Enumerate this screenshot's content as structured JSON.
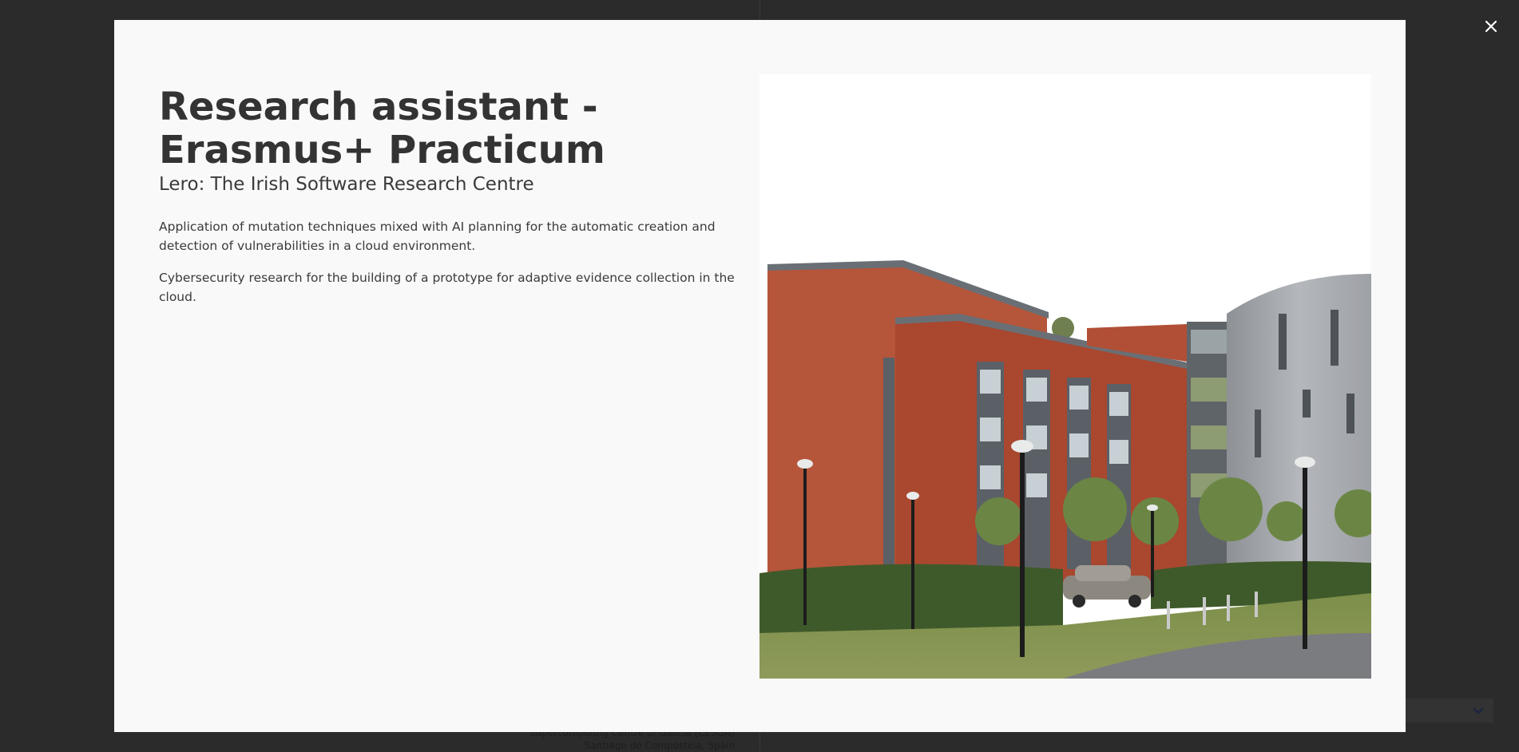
{
  "modal": {
    "title": "Research assistant - Erasmus+ Practicum",
    "organization": "Lero: The Irish Software Research Centre",
    "descriptions": [
      "Application of mutation techniques mixed with AI planning for the automatic creation and detection of vulnerabilities in a cloud environment.",
      "Cybersecurity research for the building of a prototype for adaptive evidence collection in the cloud."
    ],
    "image_icon": "building-photo"
  },
  "close_icon": "close-icon",
  "background": {
    "bottom_text_line1": "Supercomputing Centre of Galicia (CESGA)",
    "bottom_text_line2": "Santiago de Compostela, Spain",
    "dropdown_icon": "chevron-down-icon"
  },
  "colors": {
    "backdrop": "#2b2b2b",
    "modal_bg": "#f9f9f9",
    "text": "#333333"
  }
}
